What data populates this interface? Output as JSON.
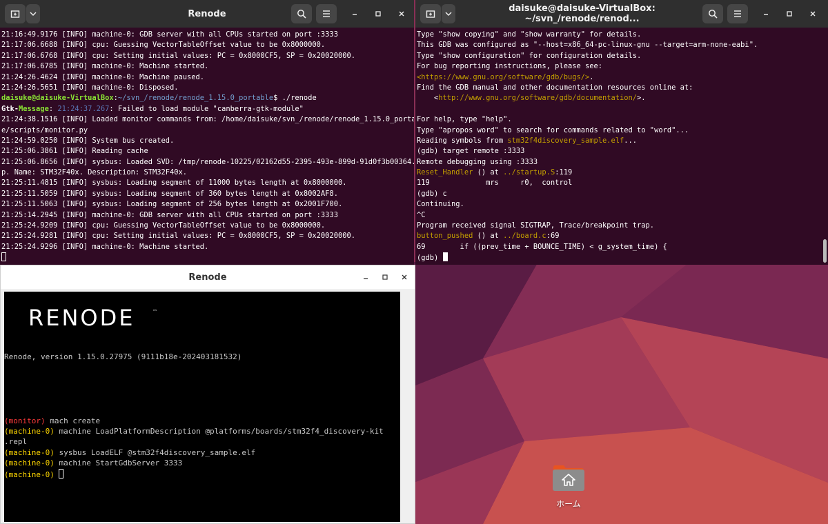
{
  "left_terminal": {
    "title": "Renode",
    "lines": [
      {
        "parts": [
          {
            "t": "21:16:49.9176 [INFO] machine-0: GDB server with all CPUs started on port :3333"
          }
        ]
      },
      {
        "parts": [
          {
            "t": "21:17:06.6688 [INFO] cpu: Guessing VectorTableOffset value to be 0x8000000."
          }
        ]
      },
      {
        "parts": [
          {
            "t": "21:17:06.6768 [INFO] cpu: Setting initial values: PC = 0x8000CF5, SP = 0x20020000."
          }
        ]
      },
      {
        "parts": [
          {
            "t": "21:17:06.6785 [INFO] machine-0: Machine started."
          }
        ]
      },
      {
        "parts": [
          {
            "t": "21:24:26.4624 [INFO] machine-0: Machine paused."
          }
        ]
      },
      {
        "parts": [
          {
            "t": "21:24:26.5651 [INFO] machine-0: Disposed."
          }
        ]
      },
      {
        "parts": [
          {
            "t": "daisuke@daisuke-VirtualBox",
            "c": "c-green"
          },
          {
            "t": ":"
          },
          {
            "t": "~/svn_/renode/renode_1.15.0_portable",
            "c": "c-blue"
          },
          {
            "t": "$ ./renode"
          }
        ]
      },
      {
        "parts": [
          {
            "t": "Gtk-",
            "c": "c-bold"
          },
          {
            "t": "Message",
            "c": "c-green"
          },
          {
            "t": ": "
          },
          {
            "t": "21:24:37.267",
            "c": "c-dim"
          },
          {
            "t": ": Failed to load module \"canberra-gtk-module\""
          }
        ]
      },
      {
        "parts": [
          {
            "t": "21:24:38.1516 [INFO] Loaded monitor commands from: /home/daisuke/svn_/renode/renode_1.15.0_portabl"
          }
        ]
      },
      {
        "parts": [
          {
            "t": "e/scripts/monitor.py"
          }
        ]
      },
      {
        "parts": [
          {
            "t": "21:24:59.0250 [INFO] System bus created."
          }
        ]
      },
      {
        "parts": [
          {
            "t": "21:25:06.3861 [INFO] Reading cache"
          }
        ]
      },
      {
        "parts": [
          {
            "t": "21:25:06.8656 [INFO] sysbus: Loaded SVD: /tmp/renode-10225/02162d55-2395-493e-899d-91d0f3b00364.tm"
          }
        ]
      },
      {
        "parts": [
          {
            "t": "p. Name: STM32F40x. Description: STM32F40x."
          }
        ]
      },
      {
        "parts": [
          {
            "t": "21:25:11.4815 [INFO] sysbus: Loading segment of 11000 bytes length at 0x8000000."
          }
        ]
      },
      {
        "parts": [
          {
            "t": "21:25:11.5059 [INFO] sysbus: Loading segment of 360 bytes length at 0x8002AF8."
          }
        ]
      },
      {
        "parts": [
          {
            "t": "21:25:11.5063 [INFO] sysbus: Loading segment of 256 bytes length at 0x2001F700."
          }
        ]
      },
      {
        "parts": [
          {
            "t": "21:25:14.2945 [INFO] machine-0: GDB server with all CPUs started on port :3333"
          }
        ]
      },
      {
        "parts": [
          {
            "t": "21:25:24.9209 [INFO] cpu: Guessing VectorTableOffset value to be 0x8000000."
          }
        ]
      },
      {
        "parts": [
          {
            "t": "21:25:24.9281 [INFO] cpu: Setting initial values: PC = 0x8000CF5, SP = 0x20020000."
          }
        ]
      },
      {
        "parts": [
          {
            "t": "21:25:24.9296 [INFO] machine-0: Machine started."
          }
        ]
      }
    ]
  },
  "right_terminal": {
    "title": "daisuke@daisuke-VirtualBox: ~/svn_/renode/renod...",
    "lines": [
      {
        "parts": [
          {
            "t": "Type \"show copying\" and \"show warranty\" for details."
          }
        ]
      },
      {
        "parts": [
          {
            "t": "This GDB was configured as \"--host=x86_64-pc-linux-gnu --target=arm-none-eabi\"."
          }
        ]
      },
      {
        "parts": [
          {
            "t": "Type \"show configuration\" for configuration details."
          }
        ]
      },
      {
        "parts": [
          {
            "t": "For bug reporting instructions, please see:"
          }
        ]
      },
      {
        "parts": [
          {
            "t": "<https://www.gnu.org/software/gdb/bugs/>",
            "c": "c-yel"
          },
          {
            "t": "."
          }
        ]
      },
      {
        "parts": [
          {
            "t": "Find the GDB manual and other documentation resources online at:"
          }
        ]
      },
      {
        "parts": [
          {
            "t": "    <"
          },
          {
            "t": "http://www.gnu.org/software/gdb/documentation/",
            "c": "c-yel"
          },
          {
            "t": ">."
          }
        ]
      },
      {
        "parts": [
          {
            "t": ""
          }
        ]
      },
      {
        "parts": [
          {
            "t": "For help, type \"help\"."
          }
        ]
      },
      {
        "parts": [
          {
            "t": "Type \"apropos word\" to search for commands related to \"word\"..."
          }
        ]
      },
      {
        "parts": [
          {
            "t": "Reading symbols from "
          },
          {
            "t": "stm32f4discovery_sample.elf",
            "c": "c-yel"
          },
          {
            "t": "..."
          }
        ]
      },
      {
        "parts": [
          {
            "t": "(gdb) target remote :3333"
          }
        ]
      },
      {
        "parts": [
          {
            "t": "Remote debugging using :3333"
          }
        ]
      },
      {
        "parts": [
          {
            "t": "Reset_Handler",
            "c": "c-yel"
          },
          {
            "t": " () at "
          },
          {
            "t": "../startup.S",
            "c": "c-yel"
          },
          {
            "t": ":119"
          }
        ]
      },
      {
        "parts": [
          {
            "t": "119             mrs     r0,  control"
          }
        ]
      },
      {
        "parts": [
          {
            "t": "(gdb) c"
          }
        ]
      },
      {
        "parts": [
          {
            "t": "Continuing."
          }
        ]
      },
      {
        "parts": [
          {
            "t": "^C"
          }
        ]
      },
      {
        "parts": [
          {
            "t": "Program received signal SIGTRAP, Trace/breakpoint trap."
          }
        ]
      },
      {
        "parts": [
          {
            "t": "button_pushed",
            "c": "c-yel"
          },
          {
            "t": " () at "
          },
          {
            "t": "../board.c",
            "c": "c-yel"
          },
          {
            "t": ":69"
          }
        ]
      },
      {
        "parts": [
          {
            "t": "69        if ((prev_time + BOUNCE_TIME) < g_system_time) {"
          }
        ]
      }
    ],
    "prompt": "(gdb) "
  },
  "renode_window": {
    "title": "Renode",
    "logo_text": "RENODE",
    "logo_tm": "™",
    "version": "Renode, version 1.15.0.27975 (9111b18e-202403181532)",
    "lines": [
      {
        "prompt": "(monitor)",
        "pc": "c-red",
        "cmd": " mach create"
      },
      {
        "prompt": "(machine-0)",
        "pc": "c-y2",
        "cmd": " machine LoadPlatformDescription @platforms/boards/stm32f4_discovery-kit"
      },
      {
        "prompt": "",
        "pc": "",
        "cmd": ".repl"
      },
      {
        "prompt": "(machine-0)",
        "pc": "c-y2",
        "cmd": " sysbus LoadELF @stm32f4discovery_sample.elf"
      },
      {
        "prompt": "(machine-0)",
        "pc": "c-y2",
        "cmd": " machine StartGdbServer 3333"
      }
    ],
    "active_prompt": "(machine-0) "
  },
  "desktop": {
    "home_label": "ホーム"
  }
}
